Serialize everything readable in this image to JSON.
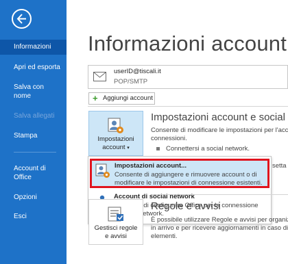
{
  "sidebar": {
    "items": [
      {
        "label": "Informazioni",
        "active": true
      },
      {
        "label": "Apri ed esporta"
      },
      {
        "label": "Salva con nome"
      },
      {
        "label": "Salva allegati",
        "disabled": true
      },
      {
        "label": "Stampa"
      },
      {
        "label": "Account di Office"
      },
      {
        "label": "Opzioni"
      },
      {
        "label": "Esci"
      }
    ],
    "back_icon": "back-arrow-icon"
  },
  "main": {
    "title": "Informazioni account",
    "account": {
      "email": "userID@tiscali.it",
      "type": "POP/SMTP"
    },
    "add_account_label": "Aggiungi account",
    "settings_section": {
      "button_label_line1": "Impostazioni",
      "button_label_line2": "account",
      "button_caret": "▾",
      "title": "Impostazioni account e social n",
      "desc_line1": "Consente di modificare le impostazioni per l'acc",
      "desc_line2": "connessioni.",
      "bullet": "Connettersi a social network.",
      "partial_right": "setta p"
    },
    "dropdown": [
      {
        "title": "Impostazioni account...",
        "desc_line1": "Consente di aggiungere e rimuovere account o di",
        "desc_line2": "modificare le impostazioni di connessione esistenti.",
        "highlighted": true
      },
      {
        "title_underlined": "A",
        "title_rest": "ccount di social network",
        "desc_line1": "Consente di configurare Office per la connessione",
        "desc_line2": "ai social network."
      }
    ],
    "rules_section": {
      "button_label_line1": "Gestisci regole",
      "button_label_line2": "e avvisi",
      "title": "Regole e avvisi",
      "desc_line1": "È possibile utilizzare Regole e avvisi per organizza",
      "desc_line2": "in arrivo e per ricevere aggiornamenti in caso di a",
      "desc_line3": "elementi."
    }
  },
  "colors": {
    "sidebar_bg": "#1e72c8",
    "sidebar_active": "#0e56a8",
    "highlight_bg": "#cde6f7",
    "highlight_border": "#e0141e"
  }
}
